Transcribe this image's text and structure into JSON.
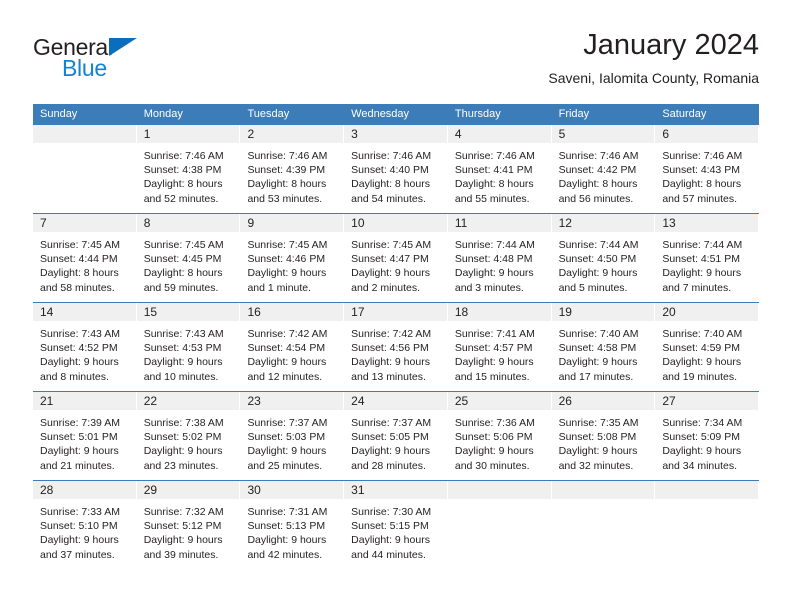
{
  "logo": {
    "word_top": "General",
    "word_bottom": "Blue",
    "triangle_icon": "triangle-icon",
    "color_dark": "#231f20",
    "color_blue": "#1283d4"
  },
  "header": {
    "title": "January 2024",
    "subtitle": "Saveni, Ialomita County, Romania"
  },
  "theme": {
    "header_band": "#3c7cb8",
    "day_number_band": "#f0f0f0",
    "text": "#231f20"
  },
  "weekdays": [
    "Sunday",
    "Monday",
    "Tuesday",
    "Wednesday",
    "Thursday",
    "Friday",
    "Saturday"
  ],
  "weeks": [
    [
      {
        "day": "",
        "lines": []
      },
      {
        "day": "1",
        "lines": [
          "Sunrise: 7:46 AM",
          "Sunset: 4:38 PM",
          "Daylight: 8 hours",
          "and 52 minutes."
        ]
      },
      {
        "day": "2",
        "lines": [
          "Sunrise: 7:46 AM",
          "Sunset: 4:39 PM",
          "Daylight: 8 hours",
          "and 53 minutes."
        ]
      },
      {
        "day": "3",
        "lines": [
          "Sunrise: 7:46 AM",
          "Sunset: 4:40 PM",
          "Daylight: 8 hours",
          "and 54 minutes."
        ]
      },
      {
        "day": "4",
        "lines": [
          "Sunrise: 7:46 AM",
          "Sunset: 4:41 PM",
          "Daylight: 8 hours",
          "and 55 minutes."
        ]
      },
      {
        "day": "5",
        "lines": [
          "Sunrise: 7:46 AM",
          "Sunset: 4:42 PM",
          "Daylight: 8 hours",
          "and 56 minutes."
        ]
      },
      {
        "day": "6",
        "lines": [
          "Sunrise: 7:46 AM",
          "Sunset: 4:43 PM",
          "Daylight: 8 hours",
          "and 57 minutes."
        ]
      }
    ],
    [
      {
        "day": "7",
        "lines": [
          "Sunrise: 7:45 AM",
          "Sunset: 4:44 PM",
          "Daylight: 8 hours",
          "and 58 minutes."
        ]
      },
      {
        "day": "8",
        "lines": [
          "Sunrise: 7:45 AM",
          "Sunset: 4:45 PM",
          "Daylight: 8 hours",
          "and 59 minutes."
        ]
      },
      {
        "day": "9",
        "lines": [
          "Sunrise: 7:45 AM",
          "Sunset: 4:46 PM",
          "Daylight: 9 hours",
          "and 1 minute."
        ]
      },
      {
        "day": "10",
        "lines": [
          "Sunrise: 7:45 AM",
          "Sunset: 4:47 PM",
          "Daylight: 9 hours",
          "and 2 minutes."
        ]
      },
      {
        "day": "11",
        "lines": [
          "Sunrise: 7:44 AM",
          "Sunset: 4:48 PM",
          "Daylight: 9 hours",
          "and 3 minutes."
        ]
      },
      {
        "day": "12",
        "lines": [
          "Sunrise: 7:44 AM",
          "Sunset: 4:50 PM",
          "Daylight: 9 hours",
          "and 5 minutes."
        ]
      },
      {
        "day": "13",
        "lines": [
          "Sunrise: 7:44 AM",
          "Sunset: 4:51 PM",
          "Daylight: 9 hours",
          "and 7 minutes."
        ]
      }
    ],
    [
      {
        "day": "14",
        "lines": [
          "Sunrise: 7:43 AM",
          "Sunset: 4:52 PM",
          "Daylight: 9 hours",
          "and 8 minutes."
        ]
      },
      {
        "day": "15",
        "lines": [
          "Sunrise: 7:43 AM",
          "Sunset: 4:53 PM",
          "Daylight: 9 hours",
          "and 10 minutes."
        ]
      },
      {
        "day": "16",
        "lines": [
          "Sunrise: 7:42 AM",
          "Sunset: 4:54 PM",
          "Daylight: 9 hours",
          "and 12 minutes."
        ]
      },
      {
        "day": "17",
        "lines": [
          "Sunrise: 7:42 AM",
          "Sunset: 4:56 PM",
          "Daylight: 9 hours",
          "and 13 minutes."
        ]
      },
      {
        "day": "18",
        "lines": [
          "Sunrise: 7:41 AM",
          "Sunset: 4:57 PM",
          "Daylight: 9 hours",
          "and 15 minutes."
        ]
      },
      {
        "day": "19",
        "lines": [
          "Sunrise: 7:40 AM",
          "Sunset: 4:58 PM",
          "Daylight: 9 hours",
          "and 17 minutes."
        ]
      },
      {
        "day": "20",
        "lines": [
          "Sunrise: 7:40 AM",
          "Sunset: 4:59 PM",
          "Daylight: 9 hours",
          "and 19 minutes."
        ]
      }
    ],
    [
      {
        "day": "21",
        "lines": [
          "Sunrise: 7:39 AM",
          "Sunset: 5:01 PM",
          "Daylight: 9 hours",
          "and 21 minutes."
        ]
      },
      {
        "day": "22",
        "lines": [
          "Sunrise: 7:38 AM",
          "Sunset: 5:02 PM",
          "Daylight: 9 hours",
          "and 23 minutes."
        ]
      },
      {
        "day": "23",
        "lines": [
          "Sunrise: 7:37 AM",
          "Sunset: 5:03 PM",
          "Daylight: 9 hours",
          "and 25 minutes."
        ]
      },
      {
        "day": "24",
        "lines": [
          "Sunrise: 7:37 AM",
          "Sunset: 5:05 PM",
          "Daylight: 9 hours",
          "and 28 minutes."
        ]
      },
      {
        "day": "25",
        "lines": [
          "Sunrise: 7:36 AM",
          "Sunset: 5:06 PM",
          "Daylight: 9 hours",
          "and 30 minutes."
        ]
      },
      {
        "day": "26",
        "lines": [
          "Sunrise: 7:35 AM",
          "Sunset: 5:08 PM",
          "Daylight: 9 hours",
          "and 32 minutes."
        ]
      },
      {
        "day": "27",
        "lines": [
          "Sunrise: 7:34 AM",
          "Sunset: 5:09 PM",
          "Daylight: 9 hours",
          "and 34 minutes."
        ]
      }
    ],
    [
      {
        "day": "28",
        "lines": [
          "Sunrise: 7:33 AM",
          "Sunset: 5:10 PM",
          "Daylight: 9 hours",
          "and 37 minutes."
        ]
      },
      {
        "day": "29",
        "lines": [
          "Sunrise: 7:32 AM",
          "Sunset: 5:12 PM",
          "Daylight: 9 hours",
          "and 39 minutes."
        ]
      },
      {
        "day": "30",
        "lines": [
          "Sunrise: 7:31 AM",
          "Sunset: 5:13 PM",
          "Daylight: 9 hours",
          "and 42 minutes."
        ]
      },
      {
        "day": "31",
        "lines": [
          "Sunrise: 7:30 AM",
          "Sunset: 5:15 PM",
          "Daylight: 9 hours",
          "and 44 minutes."
        ]
      },
      {
        "day": "",
        "lines": []
      },
      {
        "day": "",
        "lines": []
      },
      {
        "day": "",
        "lines": []
      }
    ]
  ]
}
